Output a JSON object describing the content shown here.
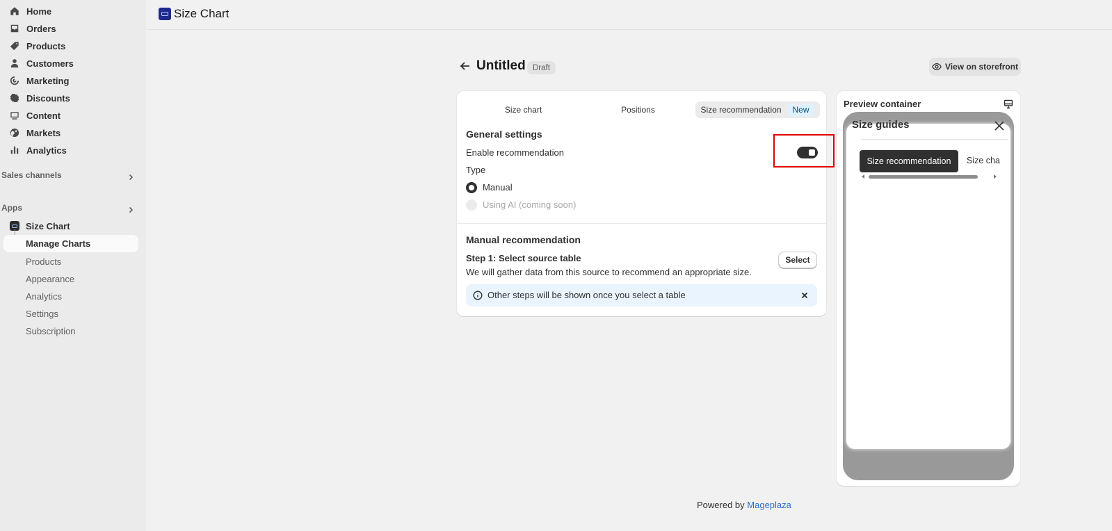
{
  "sidebar": {
    "nav": [
      {
        "label": "Home",
        "icon": "home-icon"
      },
      {
        "label": "Orders",
        "icon": "inbox-icon"
      },
      {
        "label": "Products",
        "icon": "tag-icon"
      },
      {
        "label": "Customers",
        "icon": "person-icon"
      },
      {
        "label": "Marketing",
        "icon": "target-icon"
      },
      {
        "label": "Discounts",
        "icon": "discount-icon"
      },
      {
        "label": "Content",
        "icon": "content-icon"
      },
      {
        "label": "Markets",
        "icon": "globe-icon"
      },
      {
        "label": "Analytics",
        "icon": "bar-chart-icon"
      }
    ],
    "sales_channels": "Sales channels",
    "apps": "Apps",
    "app_name": "Size Chart",
    "manage_charts": "Manage Charts",
    "sub_items": [
      "Products",
      "Appearance",
      "Analytics",
      "Settings",
      "Subscription"
    ]
  },
  "topbar": {
    "title": "Size Chart"
  },
  "page": {
    "title": "Untitled",
    "status_badge": "Draft",
    "storefront_button": "View on storefront"
  },
  "tabs": {
    "size_chart": "Size chart",
    "positions": "Positions",
    "size_recommendation": "Size recommendation",
    "new_badge": "New"
  },
  "general": {
    "heading": "General settings",
    "enable_label": "Enable recommendation",
    "enabled": true,
    "type_label": "Type",
    "option_manual": "Manual",
    "option_ai": "Using AI (coming soon)"
  },
  "manual": {
    "heading": "Manual recommendation",
    "step1_title": "Step 1: Select source table",
    "step1_desc": "We will gather data from this source to recommend an appropriate size.",
    "select_button": "Select",
    "info_text": "Other steps will be shown once you select a table"
  },
  "preview": {
    "title": "Preview container",
    "modal_title": "Size guides",
    "tab_active": "Size recommendation",
    "tab_other": "Size chart"
  },
  "footer": {
    "prefix": "Powered by",
    "link": "Mageplaza"
  }
}
